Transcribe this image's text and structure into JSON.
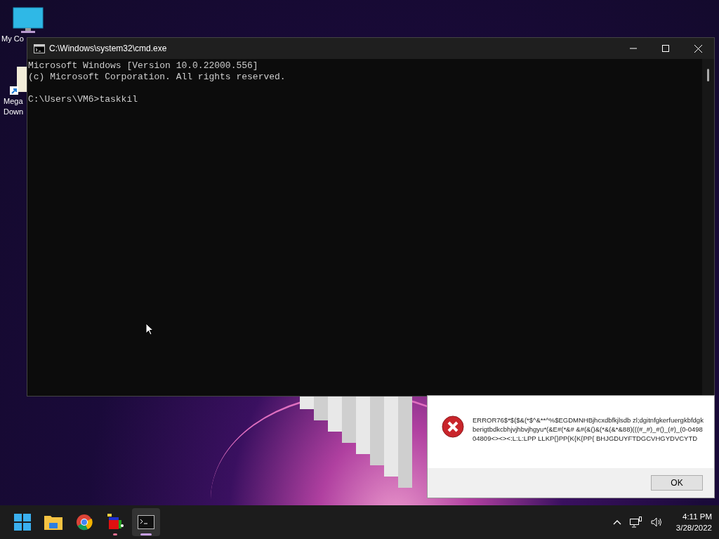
{
  "desktop_icons": [
    {
      "kind": "monitor",
      "lines": [
        "My Co"
      ]
    },
    {
      "kind": "shortcut",
      "lines": [
        "Mega",
        "Down"
      ]
    }
  ],
  "console_window": {
    "title": "C:\\Windows\\system32\\cmd.exe",
    "banner": [
      "Microsoft Windows [Version 10.0.22000.556]",
      "(c) Microsoft Corporation. All rights reserved."
    ],
    "prompt": "C:\\Users\\VM6>taskkil"
  },
  "error_dialog": {
    "message": "ERROR76$*$($&(*$^&**^%$EGDMNHBjhcxdbfkjlsdb zl;dgitnfgkerfuergkbfdgkberigtbdkcbhjvjhbvjhgyu*(&E#(*&# &#(&()&(*&(&*&88)(((#_#)_#()_(#)_(0-049804809<><><:L:L:LPP LLKP{}PP{K{K{PP{ BHJGDUYFTDGCVHGYDVCYTD",
    "button": "OK"
  },
  "taskbar": {
    "apps": [
      {
        "kind": "start",
        "selected": false,
        "running": false
      },
      {
        "kind": "folder",
        "selected": false,
        "running": false
      },
      {
        "kind": "browser",
        "selected": false,
        "running": false
      },
      {
        "kind": "blocks",
        "selected": false,
        "running": true
      },
      {
        "kind": "terminal",
        "selected": true,
        "running": true
      }
    ],
    "time": "4:11 PM",
    "date": "3/28/2022"
  }
}
